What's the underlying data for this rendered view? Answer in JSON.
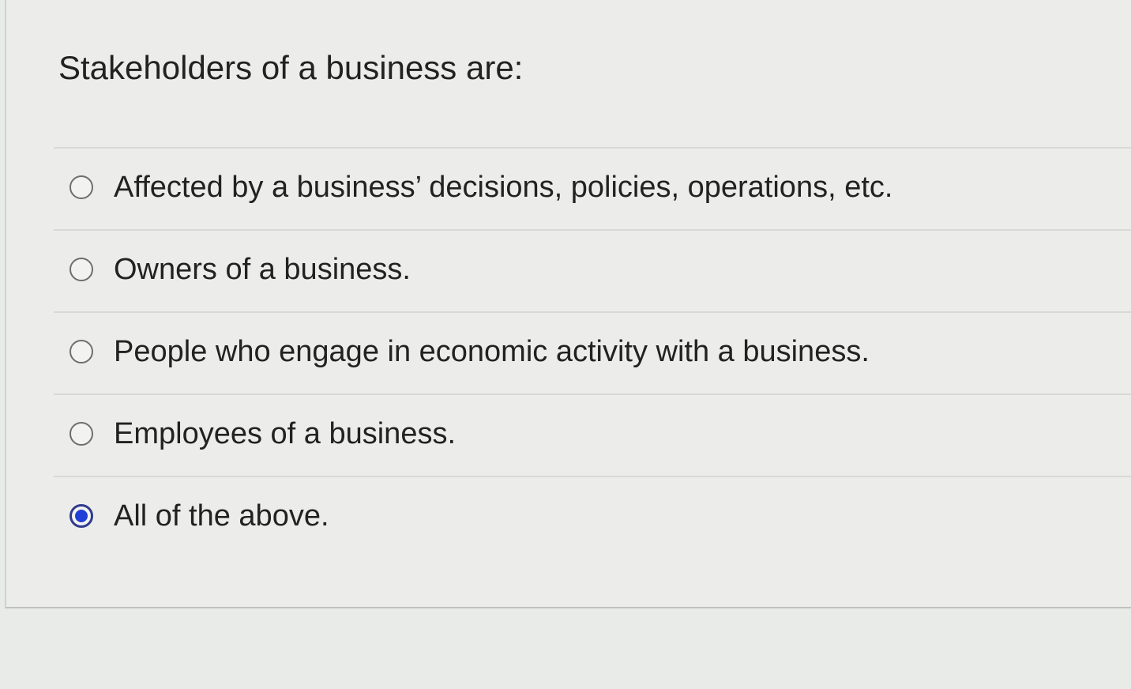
{
  "question": {
    "text": "Stakeholders of a business are:"
  },
  "options": [
    {
      "label": "Affected by a business’ decisions, policies, operations, etc.",
      "selected": false
    },
    {
      "label": "Owners of a business.",
      "selected": false
    },
    {
      "label": "People who engage in economic activity with a business.",
      "selected": false
    },
    {
      "label": "Employees of a business.",
      "selected": false
    },
    {
      "label": "All of the above.",
      "selected": true
    }
  ],
  "colors": {
    "selected_radio": "#1f3fd6",
    "text": "#222222",
    "background": "#ecedea"
  }
}
